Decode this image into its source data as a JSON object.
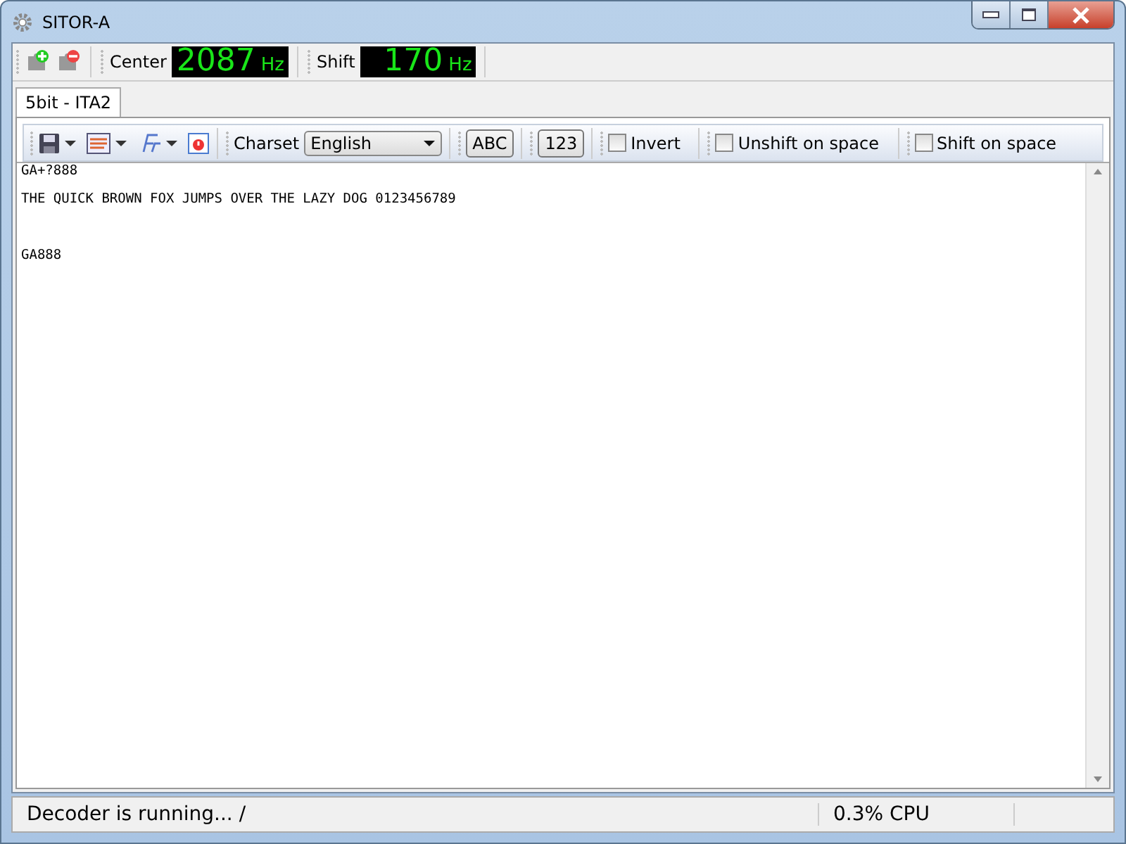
{
  "window": {
    "title": "SITOR-A"
  },
  "top_toolbar": {
    "center_label": "Center",
    "center_value": "2087",
    "center_unit": "Hz",
    "shift_label": "Shift",
    "shift_value": "170",
    "shift_unit": "Hz"
  },
  "tabs": [
    {
      "label": "5bit - ITA2",
      "selected": true
    }
  ],
  "toolbar": {
    "charset_label": "Charset",
    "charset_value": "English",
    "buttons": [
      "ABC",
      "123"
    ],
    "checkboxes": [
      {
        "label": "Invert",
        "checked": false
      },
      {
        "label": "Unshift on space",
        "checked": false
      },
      {
        "label": "Shift on space",
        "checked": false
      }
    ]
  },
  "output_lines": [
    "GA+?888",
    "THE QUICK BROWN FOX JUMPS OVER THE LAZY DOG 0123456789",
    "GA888"
  ],
  "status_bar": {
    "message": "Decoder is running... /",
    "cpu": "0.3% CPU"
  }
}
